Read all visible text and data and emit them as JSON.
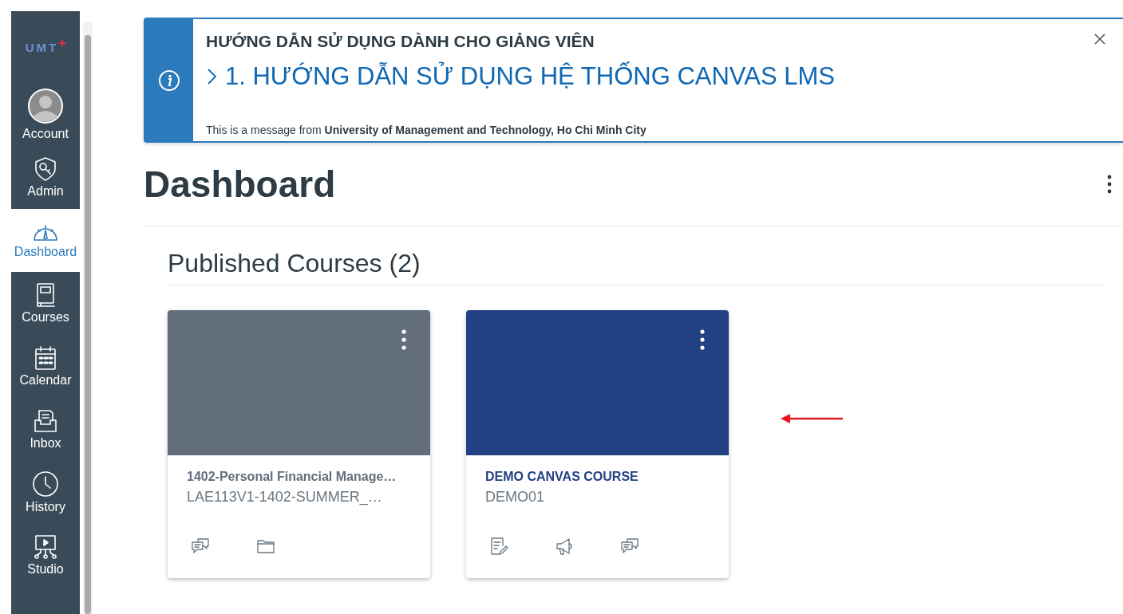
{
  "nav": {
    "logo": "UMT",
    "items": [
      {
        "label": "Account",
        "kind": "avatar",
        "selected": false
      },
      {
        "label": "Admin",
        "kind": "admin",
        "selected": false
      },
      {
        "label": "Dashboard",
        "kind": "dashboard",
        "selected": true
      },
      {
        "label": "Courses",
        "kind": "courses",
        "selected": false
      },
      {
        "label": "Calendar",
        "kind": "calendar",
        "selected": false
      },
      {
        "label": "Inbox",
        "kind": "inbox",
        "selected": false
      },
      {
        "label": "History",
        "kind": "history",
        "selected": false
      },
      {
        "label": "Studio",
        "kind": "studio",
        "selected": false
      }
    ]
  },
  "announcement": {
    "heading": "HƯỚNG DẪN SỬ DỤNG DÀNH CHO GIẢNG VIÊN",
    "link": "1. HƯỚNG DẪN SỬ DỤNG HỆ THỐNG CANVAS LMS",
    "message": "This is a message from **University of Management and Technology, Ho Chi Minh City**"
  },
  "page_title": "Dashboard",
  "section_title": "Published Courses (2)",
  "courses": [
    {
      "title": "1402-Personal Financial Manage…",
      "code": "LAE113V1-1402-SUMMER_…",
      "color": "#626e7b",
      "actions": [
        {
          "kind": "discussions"
        },
        {
          "kind": "files"
        }
      ]
    },
    {
      "title": "DEMO CANVAS COURSE",
      "code": "DEMO01",
      "color": "#234184",
      "actions": [
        {
          "kind": "assignments"
        },
        {
          "kind": "announcements"
        },
        {
          "kind": "discussions"
        }
      ]
    }
  ]
}
